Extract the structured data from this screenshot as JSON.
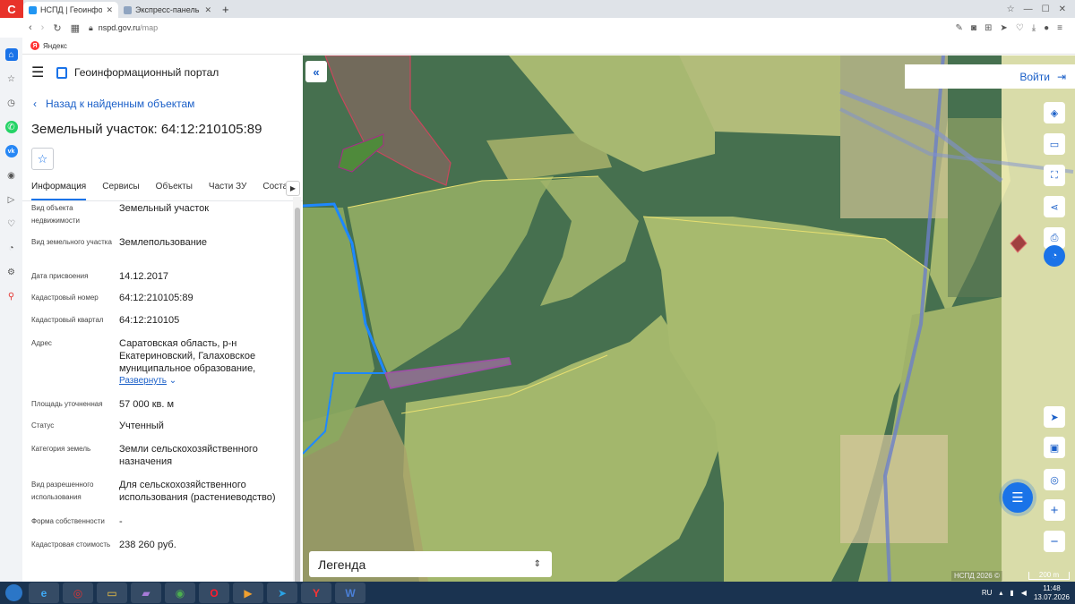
{
  "browser": {
    "brand_letter": "С",
    "tabs": [
      {
        "label": "НСПД | Геоинформационн",
        "active": true
      },
      {
        "label": "Экспресс-панель",
        "active": false
      }
    ],
    "new_tab": "+",
    "url_host": "nspd.gov.ru",
    "url_path": "/map",
    "bookmark": "Яндекс"
  },
  "portal": {
    "title": "Геоинформационный портал",
    "back_label": "Назад к найденным объектам",
    "object_title": "Земельный участок: 64:12:210105:89",
    "tabs": [
      "Информация",
      "Сервисы",
      "Объекты",
      "Части ЗУ",
      "Состав"
    ],
    "active_tab": "Информация"
  },
  "properties": [
    {
      "label": "Вид объекта недвижимости",
      "value": "Земельный участок"
    },
    {
      "label": "Вид земельного участка",
      "value": "Землепользование"
    },
    {
      "label": "Дата присвоения",
      "value": "14.12.2017"
    },
    {
      "label": "Кадастровый номер",
      "value": "64:12:210105:89"
    },
    {
      "label": "Кадастровый квартал",
      "value": "64:12:210105"
    },
    {
      "label": "Адрес",
      "value": "Саратовская область, р-н Екатериновский, Галаховское муниципальное образование,",
      "expand": "Развернуть"
    },
    {
      "label": "Площадь уточненная",
      "value": "57 000 кв. м"
    },
    {
      "label": "Статус",
      "value": "Учтенный"
    },
    {
      "label": "Категория земель",
      "value": "Земли сельскохозяйственного назначения"
    },
    {
      "label": "Вид разрешенного использования",
      "value": "Для сельскохозяйственного использования (растениеводство)"
    },
    {
      "label": "Форма собственности",
      "value": "-"
    },
    {
      "label": "Кадастровая стоимость",
      "value": "238 260 руб."
    }
  ],
  "map": {
    "login_label": "Войти",
    "legend_label": "Легенда",
    "attribution": "НСПД 2026 ©",
    "scale_label": "200 m"
  },
  "taskbar": {
    "lang": "RU",
    "time": "11:48",
    "date": "13.07.2026"
  },
  "colors": {
    "accent": "#1a73e8",
    "parcel_highlight": "#b040c0",
    "boundary_blue": "#1e88ff",
    "field_fill": "#b8c77a"
  }
}
